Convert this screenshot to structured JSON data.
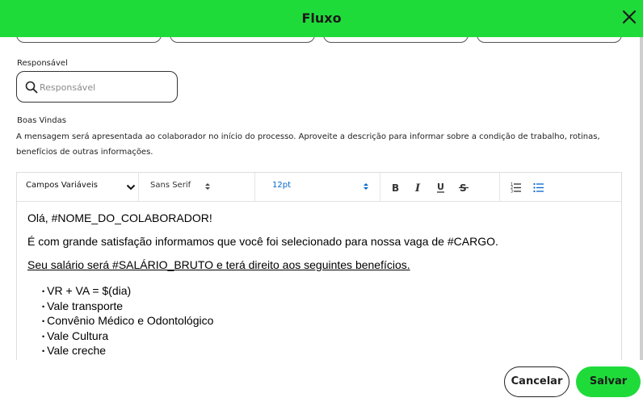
{
  "modal": {
    "title": "Fluxo",
    "close_icon": "close-icon"
  },
  "form": {
    "responsavel": {
      "label": "Responsável",
      "placeholder": "Responsável",
      "value": "",
      "icon": "search-icon"
    },
    "boas_vindas": {
      "label": "Boas Vindas",
      "description": "A mensagem será apresentada ao colaborador no início do processo. Aproveite a descrição para informar sobre a condição de trabalho, rotinas, benefícios de outras informações."
    }
  },
  "editor": {
    "toolbar": {
      "variables_select": "Campos Variáveis",
      "font_select": "Sans Serif",
      "size_select": "12pt",
      "bold_icon": "bold-icon",
      "italic_icon": "italic-icon",
      "underline_icon": "underline-icon",
      "strike_icon": "strikethrough-icon",
      "ordered_list_icon": "ordered-list-icon",
      "bullet_list_icon": "bullet-list-icon"
    },
    "content": {
      "greeting": "Olá, #NOME_DO_COLABORADOR!",
      "intro": "É com grande satisfação informamos que você foi selecionado para nossa vaga de #CARGO.",
      "salary": "Seu salário será #SALÁRIO_BRUTO e terá direito aos seguintes benefícios. ",
      "benefits": [
        "VR + VA = $(dia)",
        "Vale transporte",
        "Convênio Médico e Odontológico",
        "Vale Cultura",
        "Vale creche"
      ]
    }
  },
  "footer": {
    "cancel_label": "Cancelar",
    "save_label": "Salvar"
  },
  "colors": {
    "accent": "#1fdb3a",
    "toolbar_active": "#0066cc"
  }
}
